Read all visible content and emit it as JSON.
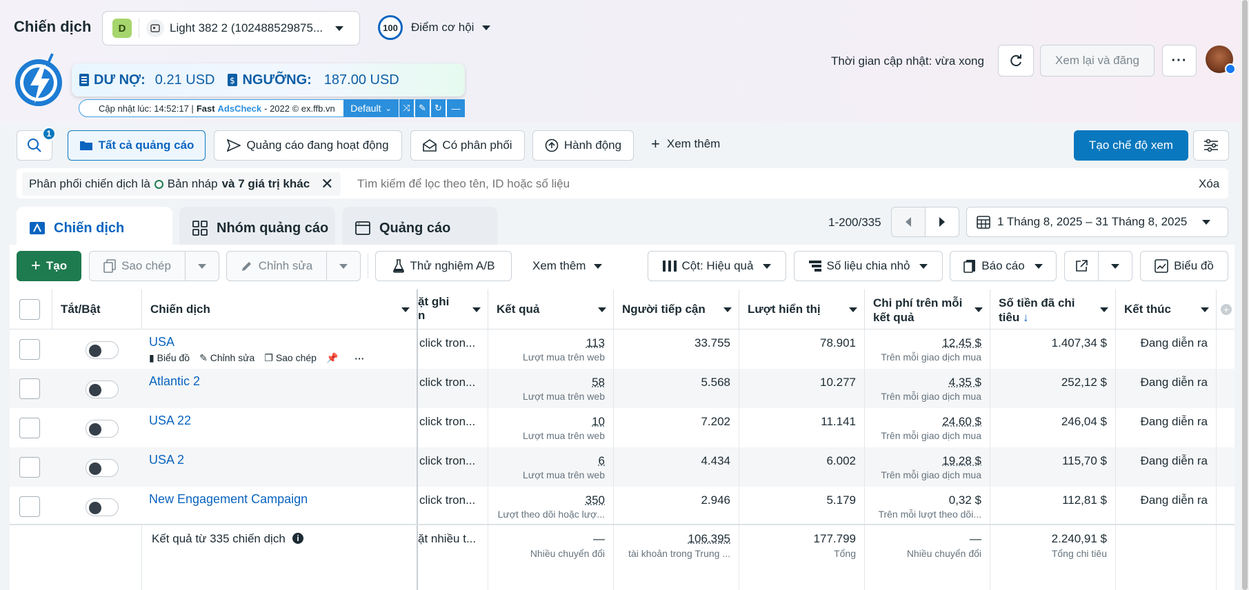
{
  "header": {
    "title": "Chiến dịch",
    "account_badge": "D",
    "account_name": "Light 382 2 (102488529875...",
    "opportunity_score": "100",
    "opportunity_label": "Điểm cơ hội",
    "update_time": "Thời gian cập nhật: vừa xong",
    "review_publish": "Xem lại và đăng"
  },
  "extension": {
    "debt_label": "DƯ NỢ:",
    "debt_value": "0.21 USD",
    "threshold_label": "NGƯỠNG:",
    "threshold_value": "187.00 USD",
    "updated_prefix": "Cập nhật lúc: 14:52:17 |",
    "brand_fast": "Fast",
    "brand_ads": "AdsCheck",
    "copyright": "- 2022 © ex.ffb.vn",
    "preset": "Default"
  },
  "filters": {
    "search_badge": "1",
    "all_ads": "Tất cả quảng cáo",
    "active_ads": "Quảng cáo đang hoạt động",
    "delivery": "Có phân phối",
    "actions": "Hành động",
    "more": "Xem thêm",
    "create_view": "Tạo chế độ xem",
    "chip_prefix": "Phân phối chiến dịch là",
    "chip_value": "Bản nháp",
    "chip_more": "và 7 giá trị khác",
    "search_placeholder": "Tìm kiếm để lọc theo tên, ID hoặc số liệu",
    "clear": "Xóa"
  },
  "tabs": [
    {
      "label": "Chiến dịch"
    },
    {
      "label": "Nhóm quảng cáo"
    },
    {
      "label": "Quảng cáo"
    }
  ],
  "pagination": "1-200/335",
  "date_range": "1 Tháng 8, 2025 – 31 Tháng 8, 2025",
  "toolbar": {
    "create": "Tạo",
    "duplicate": "Sao chép",
    "edit": "Chỉnh sửa",
    "ab_test": "Thử nghiệm A/B",
    "more": "Xem thêm",
    "columns": "Cột: Hiệu quả",
    "breakdown": "Số liệu chia nhỏ",
    "reports": "Báo cáo",
    "chart": "Biểu đồ"
  },
  "table": {
    "headers": {
      "toggle": "Tắt/Bật",
      "campaign": "Chiến dịch",
      "attribution_1": "ặt ghi",
      "attribution_2": "n",
      "results": "Kết quả",
      "reach": "Người tiếp cận",
      "impressions": "Lượt hiển thị",
      "cpr_1": "Chi phí trên mỗi",
      "cpr_2": "kết quả",
      "spent_1": "Số tiền đã chi",
      "spent_2": "tiêu",
      "ends": "Kết thúc"
    },
    "row_actions": {
      "chart": "Biểu đồ",
      "edit": "Chỉnh sửa",
      "duplicate": "Sao chép"
    },
    "rows": [
      {
        "name": "USA",
        "attribution": "click tron...",
        "results": "113",
        "results_sub": "Lượt mua trên web",
        "reach": "33.755",
        "impressions": "78.901",
        "cpr": "12,45 $",
        "cpr_sub": "Trên mỗi giao dịch mua",
        "spent": "1.407,34 $",
        "ends": "Đang diễn ra"
      },
      {
        "name": "Atlantic 2",
        "attribution": "click tron...",
        "results": "58",
        "results_sub": "Lượt mua trên web",
        "reach": "5.568",
        "impressions": "10.277",
        "cpr": "4,35 $",
        "cpr_sub": "Trên mỗi giao dịch mua",
        "spent": "252,12 $",
        "ends": "Đang diễn ra"
      },
      {
        "name": "USA 22",
        "attribution": "click tron...",
        "results": "10",
        "results_sub": "Lượt mua trên web",
        "reach": "7.202",
        "impressions": "11.141",
        "cpr": "24,60 $",
        "cpr_sub": "Trên mỗi giao dịch mua",
        "spent": "246,04 $",
        "ends": "Đang diễn ra"
      },
      {
        "name": "USA 2",
        "attribution": "click tron...",
        "results": "6",
        "results_sub": "Lượt mua trên web",
        "reach": "4.434",
        "impressions": "6.002",
        "cpr": "19,28 $",
        "cpr_sub": "Trên mỗi giao dịch mua",
        "spent": "115,70 $",
        "ends": "Đang diễn ra"
      },
      {
        "name": "New Engagement Campaign",
        "attribution": "click tron...",
        "results": "350",
        "results_sub": "Lượt theo dõi hoặc lượ...",
        "reach": "2.946",
        "impressions": "5.179",
        "cpr": "0,32 $",
        "cpr_sub": "Trên mỗi lượt theo dõi...",
        "spent": "112,81 $",
        "ends": "Đang diễn ra"
      }
    ],
    "summary": {
      "label": "Kết quả từ 335 chiến dịch",
      "attribution": "ặt nhiều t...",
      "results": "—",
      "results_sub": "Nhiều chuyển đổi",
      "reach": "106.395",
      "reach_sub": "tài khoản trong Trung ...",
      "impressions": "177.799",
      "impressions_sub": "Tổng",
      "cpr": "—",
      "cpr_sub": "Nhiều chuyển đổi",
      "spent": "2.240,91 $",
      "spent_sub": "Tổng chi tiêu"
    }
  },
  "colors": {
    "primary": "#0a78be",
    "create_green": "#1e7a4f",
    "link": "#0a64c0"
  }
}
